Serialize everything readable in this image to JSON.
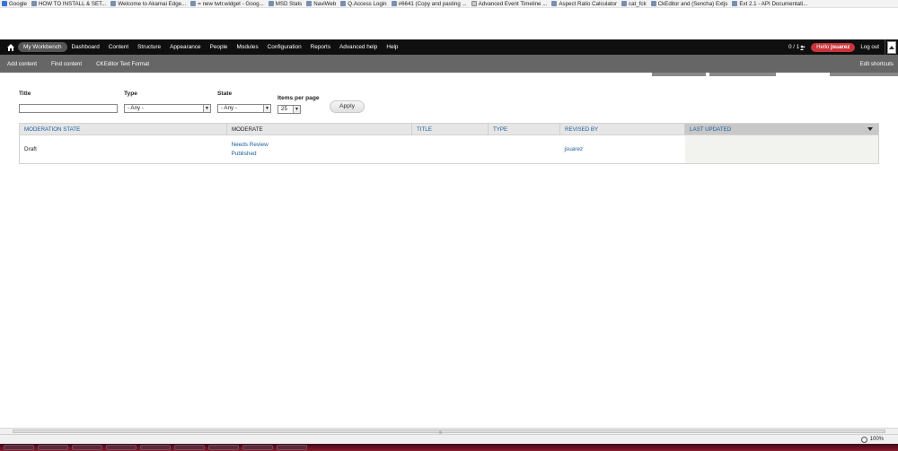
{
  "bookmarks": [
    {
      "label": "Google",
      "icon": "google-icon"
    },
    {
      "label": "HOW TO INSTALL & SET...",
      "icon": "page-icon"
    },
    {
      "label": "Welcome to Akamai Edge...",
      "icon": "page-icon"
    },
    {
      "label": "= new twtr.widget - Goog...",
      "icon": "page-icon"
    },
    {
      "label": "MSD Stats",
      "icon": "page-icon"
    },
    {
      "label": "NaviWeb",
      "icon": "page-icon"
    },
    {
      "label": "Q.Access Login",
      "icon": "page-icon"
    },
    {
      "label": "#6641 (Copy and pasting ...",
      "icon": "page-icon"
    },
    {
      "label": "Advanced Event Timeline ...",
      "icon": "page-icon"
    },
    {
      "label": "Aspect Ratio Calculator",
      "icon": "page-icon"
    },
    {
      "label": "cat_fck",
      "icon": "page-icon"
    },
    {
      "label": "CkEditor and (Sencha) Extjs",
      "icon": "page-icon"
    },
    {
      "label": "Ext 2.1 - API Documentati...",
      "icon": "page-icon"
    }
  ],
  "toolbar": {
    "menu": [
      {
        "label": "My Workbench",
        "active": true
      },
      {
        "label": "Dashboard"
      },
      {
        "label": "Content"
      },
      {
        "label": "Structure"
      },
      {
        "label": "Appearance"
      },
      {
        "label": "People"
      },
      {
        "label": "Modules"
      },
      {
        "label": "Configuration"
      },
      {
        "label": "Reports"
      },
      {
        "label": "Advanced help"
      },
      {
        "label": "Help"
      }
    ],
    "user_count": "0 / 1",
    "hello_prefix": "Hello",
    "username": "jsuarez",
    "logout": "Log out"
  },
  "shortcuts": {
    "items": [
      "Add content",
      "Find content",
      "CKEditor Text Format"
    ],
    "edit": "Edit shortcuts"
  },
  "filters": {
    "title_label": "Title",
    "title_value": "",
    "type_label": "Type",
    "type_value": "- Any -",
    "state_label": "State",
    "state_value": "- Any -",
    "items_label": "Items per page",
    "items_value": "25",
    "apply": "Apply"
  },
  "table": {
    "headers": [
      "MODERATION STATE",
      "MODERATE",
      "TITLE",
      "TYPE",
      "REVISED BY",
      "LAST UPDATED"
    ],
    "rows": [
      {
        "state": "Draft",
        "moderate": [
          "Needs Review",
          "Published"
        ],
        "title": "",
        "type": "",
        "revised_by": "jsuarez",
        "last_updated": ""
      }
    ]
  },
  "status": {
    "zoom": "100%"
  },
  "colors": {
    "toolbar_bg": "#0f0f0f",
    "shortcuts_bg": "#666666",
    "hello_badge": "#c9353a",
    "link": "#1a5f9c"
  }
}
